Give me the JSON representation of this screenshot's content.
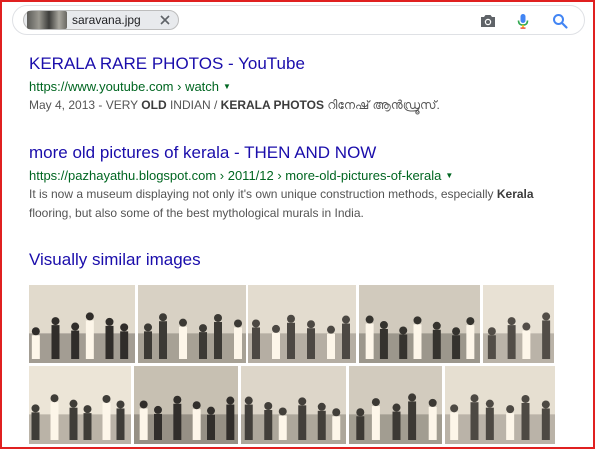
{
  "search": {
    "chip_label": "saravana.jpg",
    "icons": [
      "close-icon",
      "camera-icon",
      "microphone-icon",
      "search-icon"
    ]
  },
  "results": [
    {
      "title_parts": [
        "KERALA RARE PHOTOS",
        " - YouTube"
      ],
      "url": "https://www.youtube.com › watch",
      "date": "May 4, 2013 -",
      "snippet_parts": [
        " VERY ",
        "OLD",
        " INDIAN / ",
        "KERALA PHOTOS",
        " റിനേഷ് ആന്‍ഡ്രൂസ്."
      ]
    },
    {
      "title_parts": [
        "more old pictures of kerala",
        " - THEN AND NOW"
      ],
      "url": "https://pazhayathu.blogspot.com › 2011/12 › more-old-pictures-of-kerala",
      "snippet_line1": [
        "It is now a museum displaying not only it's own unique construction methods, especially ",
        "Kerala"
      ],
      "snippet_line2": "flooring, but also some of the best mythological murals in India."
    }
  ],
  "visually_similar": {
    "heading": "Visually similar images",
    "row1_count": 5,
    "row2_count": 5
  },
  "colors": {
    "link": "#1a0dab",
    "url_green": "#006621",
    "snippet": "#545454",
    "frame_border": "#e02020"
  }
}
